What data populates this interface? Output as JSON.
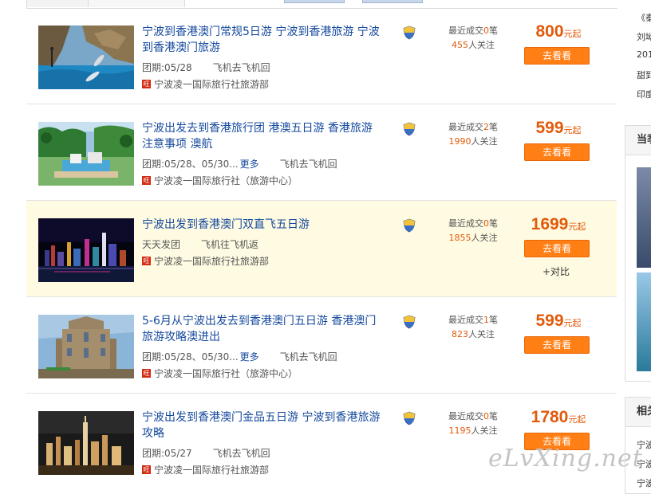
{
  "products": [
    {
      "title": "宁波到香港澳门常规5日游 宁波到香港旅游 宁波到香港澳门旅游",
      "meta_a": "团期:05/28",
      "more": "",
      "meta_b": "飞机去飞机回",
      "agency": "宁波凌一国际旅行社旅游部",
      "deals_prefix": "最近成交",
      "deals_count": "0",
      "deals_suffix": "笔",
      "watchers": "455",
      "watchers_suffix": "人关注",
      "price": "800",
      "price_unit": "元起",
      "go_label": "去看看",
      "compare_label": "",
      "image": "dolphin-show",
      "highlighted": false
    },
    {
      "title": "宁波出发去到香港旅行团 港澳五日游 香港旅游注意事项 澳航",
      "meta_a": "团期:05/28、05/30...",
      "more": "更多",
      "meta_b": "飞机去飞机回",
      "agency": "宁波凌一国际旅行社（旅游中心）",
      "deals_prefix": "最近成交",
      "deals_count": "2",
      "deals_suffix": "笔",
      "watchers": "1990",
      "watchers_suffix": "人关注",
      "price": "599",
      "price_unit": "元起",
      "go_label": "去看看",
      "compare_label": "",
      "image": "theme-park",
      "highlighted": false
    },
    {
      "title": "宁波出发到香港澳门双直飞五日游",
      "meta_a": "天天发团",
      "more": "",
      "meta_b": "飞机往飞机返",
      "agency": "宁波凌一国际旅行社旅游部",
      "deals_prefix": "最近成交",
      "deals_count": "0",
      "deals_suffix": "笔",
      "watchers": "1855",
      "watchers_suffix": "人关注",
      "price": "1699",
      "price_unit": "元起",
      "go_label": "去看看",
      "compare_label": "+对比",
      "image": "night-skyline",
      "highlighted": true
    },
    {
      "title": "5-6月从宁波出发去到香港澳门五日游 香港澳门旅游攻略澳进出",
      "meta_a": "团期:05/28、05/30...",
      "more": "更多",
      "meta_b": "飞机去飞机回",
      "agency": "宁波凌一国际旅行社（旅游中心）",
      "deals_prefix": "最近成交",
      "deals_count": "1",
      "deals_suffix": "笔",
      "watchers": "823",
      "watchers_suffix": "人关注",
      "price": "599",
      "price_unit": "元起",
      "go_label": "去看看",
      "compare_label": "",
      "image": "ruins-facade",
      "highlighted": false
    },
    {
      "title": "宁波出发到香港澳门金品五日游 宁波到香港旅游攻略",
      "meta_a": "团期:05/27",
      "more": "",
      "meta_b": "飞机去飞机回",
      "agency": "宁波凌一国际旅行社旅游部",
      "deals_prefix": "最近成交",
      "deals_count": "0",
      "deals_suffix": "笔",
      "watchers": "1195",
      "watchers_suffix": "人关注",
      "price": "1780",
      "price_unit": "元起",
      "go_label": "去看看",
      "compare_label": "",
      "image": "night-tower",
      "highlighted": false
    }
  ],
  "sidebar": {
    "lines_top": [
      "《泰",
      "刘坳",
      "201",
      "甜到",
      "印度"
    ],
    "box1_title": "当季",
    "box2_title": "相关",
    "box2_lines": [
      "宁波",
      "宁波",
      "宁波"
    ]
  },
  "watermark": "eLvXing.net",
  "colors": {
    "title_link": "#15499d",
    "price": "#e25a0b",
    "button": "#ff7f15",
    "highlight_row": "#fffbe2"
  }
}
